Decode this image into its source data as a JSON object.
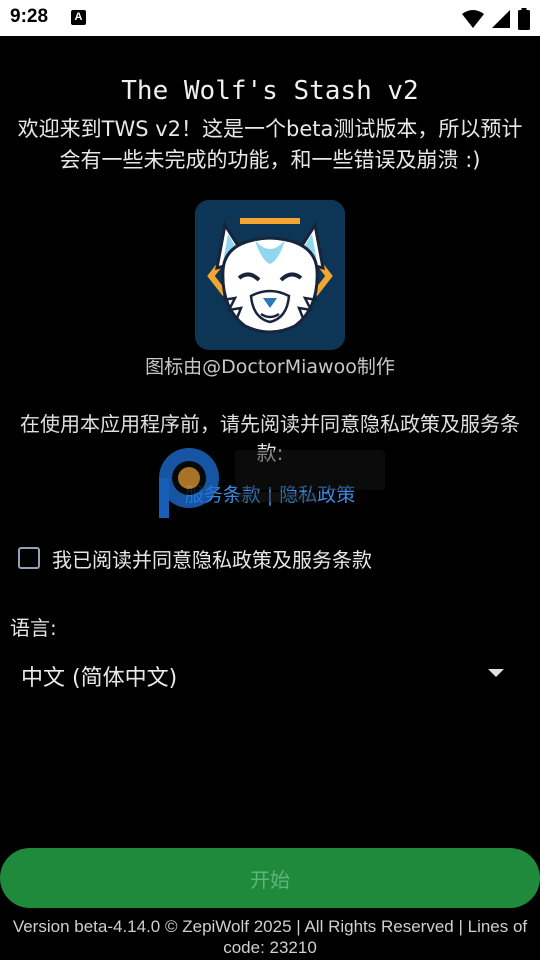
{
  "status_bar": {
    "time": "9:28",
    "notification_icon_glyph": "A"
  },
  "title": "The Wolf's Stash v2",
  "welcome_text": "欢迎来到TWS v2！这是一个beta测试版本，所以预计会有一些未完成的功能，和一些错误及崩溃 :)",
  "icon_credit": "图标由@DoctorMiawoo制作",
  "agree_prompt": "在使用本应用程序前，请先阅读并同意隐私政策及服务条款:",
  "policy_links": {
    "terms": "服务条款",
    "separator": " | ",
    "privacy": "隐私政策"
  },
  "checkbox": {
    "label": "我已阅读并同意隐私政策及服务条款",
    "checked": false
  },
  "language": {
    "label": "语言:",
    "selected": "中文 (简体中文)"
  },
  "start_button": {
    "label": "开始",
    "enabled": false
  },
  "footer": "Version beta-4.14.0 © ZepiWolf 2025 | All Rights Reserved | Lines of code: 23210",
  "colors": {
    "background": "#000000",
    "link": "#3a8ee6",
    "button_bg": "#1f8a3c",
    "button_text": "#5fb47b",
    "logo_bg": "#0d3556"
  },
  "icons": [
    "notification-a-icon",
    "wifi-icon",
    "signal-icon",
    "battery-icon",
    "wolf-logo-icon",
    "dropdown-arrow-icon"
  ]
}
